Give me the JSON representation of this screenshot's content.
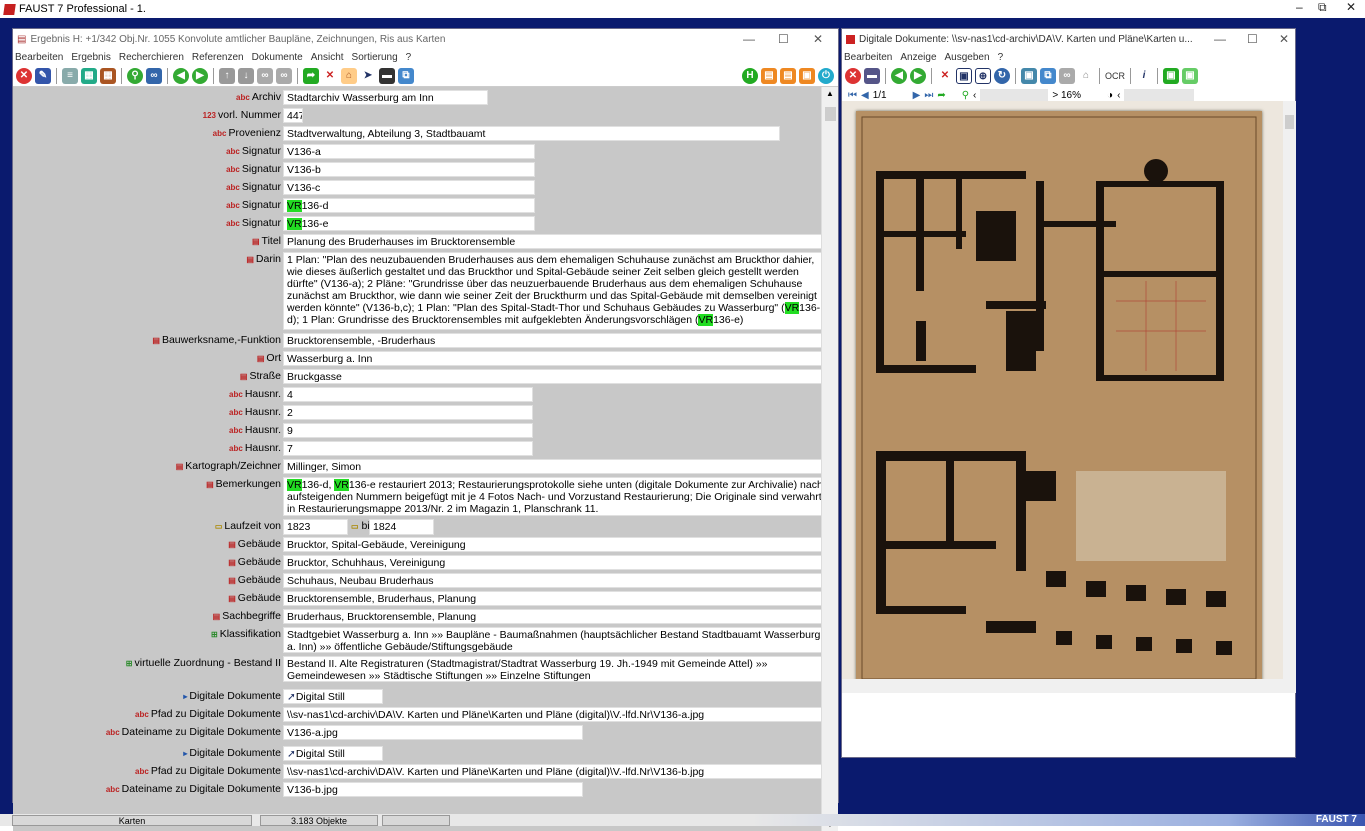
{
  "outer": {
    "title": "FAUST 7 Professional - 1.",
    "min": "–",
    "restore": "⧉",
    "close": "✕"
  },
  "left": {
    "title": "Ergebnis H: +1/342  Obj.Nr. 1055  Konvolute amtlicher Baupläne, Zeichnungen, Ris aus Karten",
    "menu": [
      "Bearbeiten",
      "Ergebnis",
      "Recherchieren",
      "Referenzen",
      "Dokumente",
      "Ansicht",
      "Sortierung",
      "?"
    ],
    "rows": [
      {
        "label": "Archiv",
        "icon": "abc",
        "value": "Stadtarchiv Wasserburg am Inn"
      },
      {
        "label": "vorl. Nummer",
        "icon": "123",
        "value": "447"
      },
      {
        "label": "Provenienz",
        "icon": "abc",
        "value": "Stadtverwaltung, Abteilung 3, Stadtbauamt"
      },
      {
        "label": "Signatur",
        "icon": "abc",
        "value": "V136-a"
      },
      {
        "label": "Signatur",
        "icon": "abc",
        "value": "V136-b"
      },
      {
        "label": "Signatur",
        "icon": "abc",
        "value": "V136-c"
      },
      {
        "label": "Signatur",
        "icon": "abc",
        "hl": "VR",
        "value": "136-d"
      },
      {
        "label": "Signatur",
        "icon": "abc",
        "hl": "VR",
        "value": "136-e"
      },
      {
        "label": "Titel",
        "icon": "doc",
        "value": "Planung des Bruderhauses im Brucktorensemble"
      }
    ],
    "darin": "1 Plan: \"Plan des neuzubauenden Bruderhauses aus dem ehemaligen Schuhause zunächst am Bruckthor dahier, wie dieses äußerlich gestaltet und das Bruckthor und Spital-Gebäude seiner Zeit selben gleich gestellt werden dürfte\" (V136-a); 2 Pläne: \"Grundrisse über das neuzuerbauende Bruderhaus aus dem ehemaligen Schuhause zunächst am Bruckthor, wie dann wie seiner Zeit der Bruckthurm und das Spital-Gebäude mit demselben vereinigt werden könnte\" (V136-b,c); 1 Plan: \"Plan des Spital-Stadt-Thor und Schuhaus Gebäudes zu Wasserburg\" (VR136-d); 1 Plan: Grundrisse des Brucktorensembles mit aufgeklebten Änderungsvorschlägen (VR136-e)",
    "darin_label": "Darin",
    "rows2": [
      {
        "label": "Bauwerksname,-Funktion",
        "icon": "doc",
        "value": "Brucktorensemble, -Bruderhaus"
      },
      {
        "label": "Ort",
        "icon": "doc",
        "value": "Wasserburg a. Inn"
      },
      {
        "label": "Straße",
        "icon": "doc",
        "value": "Bruckgasse"
      },
      {
        "label": "Hausnr.",
        "icon": "abc",
        "value": "4"
      },
      {
        "label": "Hausnr.",
        "icon": "abc",
        "value": "2"
      },
      {
        "label": "Hausnr.",
        "icon": "abc",
        "value": "9"
      },
      {
        "label": "Hausnr.",
        "icon": "abc",
        "value": "7"
      },
      {
        "label": "Kartograph/Zeichner",
        "icon": "doc",
        "value": "Millinger, Simon"
      }
    ],
    "bem_label": "Bemerkungen",
    "bem": "VR136-d, VR136-e restauriert 2013; Restaurierungsprotokolle siehe unten (digitale Dokumente zur Archivalie) nach aufsteigenden Nummern beigefügt mit je 4 Fotos Nach- und Vorzustand Restaurierung; Die Originale sind verwahrt in Restaurierungsmappe 2013/Nr. 2 im Magazin 1, Planschrank 11.",
    "laufzeit": {
      "label": "Laufzeit von",
      "from": "1823",
      "bis": "bis",
      "to": "1824"
    },
    "rows3": [
      {
        "label": "Gebäude",
        "icon": "doc",
        "value": "Brucktor, Spital-Gebäude, Vereinigung"
      },
      {
        "label": "Gebäude",
        "icon": "doc",
        "value": "Brucktor, Schuhhaus, Vereinigung"
      },
      {
        "label": "Gebäude",
        "icon": "doc",
        "value": "Schuhaus, Neubau Bruderhaus"
      },
      {
        "label": "Gebäude",
        "icon": "doc",
        "value": "Brucktorensemble, Bruderhaus, Planung"
      },
      {
        "label": "Sachbegriffe",
        "icon": "doc",
        "value": "Bruderhaus, Brucktorensemble, Planung"
      }
    ],
    "klass_label": "Klassifikation",
    "klass": "Stadtgebiet Wasserburg a. Inn »» Baupläne - Baumaßnahmen (hauptsächlicher Bestand Stadtbauamt Wasserburg a. Inn) »» öffentliche Gebäude/Stiftungsgebäude",
    "virt_label": "virtuelle Zuordnung - Bestand II",
    "virt": "Bestand II. Alte Registraturen (Stadtmagistrat/Stadtrat Wasserburg 19. Jh.-1949 mit Gemeinde Attel) »» Gemeindewesen »» Städtische Stiftungen »» Einzelne Stiftungen",
    "rows4": [
      {
        "label": "Digitale Dokumente",
        "icon": "flag",
        "value": "Digital Still Camera"
      },
      {
        "label": "Pfad zu Digitale Dokumente",
        "icon": "abc",
        "value": "\\\\sv-nas1\\cd-archiv\\DA\\V. Karten und Pläne\\Karten und Pläne (digital)\\V.-lfd.Nr\\V136-a.jpg"
      },
      {
        "label": "Dateiname zu Digitale Dokumente",
        "icon": "abc",
        "value": "V136-a.jpg"
      },
      {
        "label": "Digitale Dokumente",
        "icon": "flag",
        "value": "Digital Still Camera"
      },
      {
        "label": "Pfad zu Digitale Dokumente",
        "icon": "abc",
        "value": "\\\\sv-nas1\\cd-archiv\\DA\\V. Karten und Pläne\\Karten und Pläne (digital)\\V.-lfd.Nr\\V136-b.jpg"
      },
      {
        "label": "Dateiname zu Digitale Dokumente",
        "icon": "abc",
        "value": "V136-b.jpg"
      }
    ]
  },
  "right": {
    "title": "Digitale Dokumente: \\\\sv-nas1\\cd-archiv\\DA\\V. Karten und Pläne\\Karten u...",
    "menu": [
      "Bearbeiten",
      "Anzeige",
      "Ausgeben",
      "?"
    ],
    "page": "1/1",
    "zoom": "> 16%"
  },
  "status": {
    "left": "Karten",
    "count": "3.183 Objekte",
    "brand": "FAUST 7"
  }
}
